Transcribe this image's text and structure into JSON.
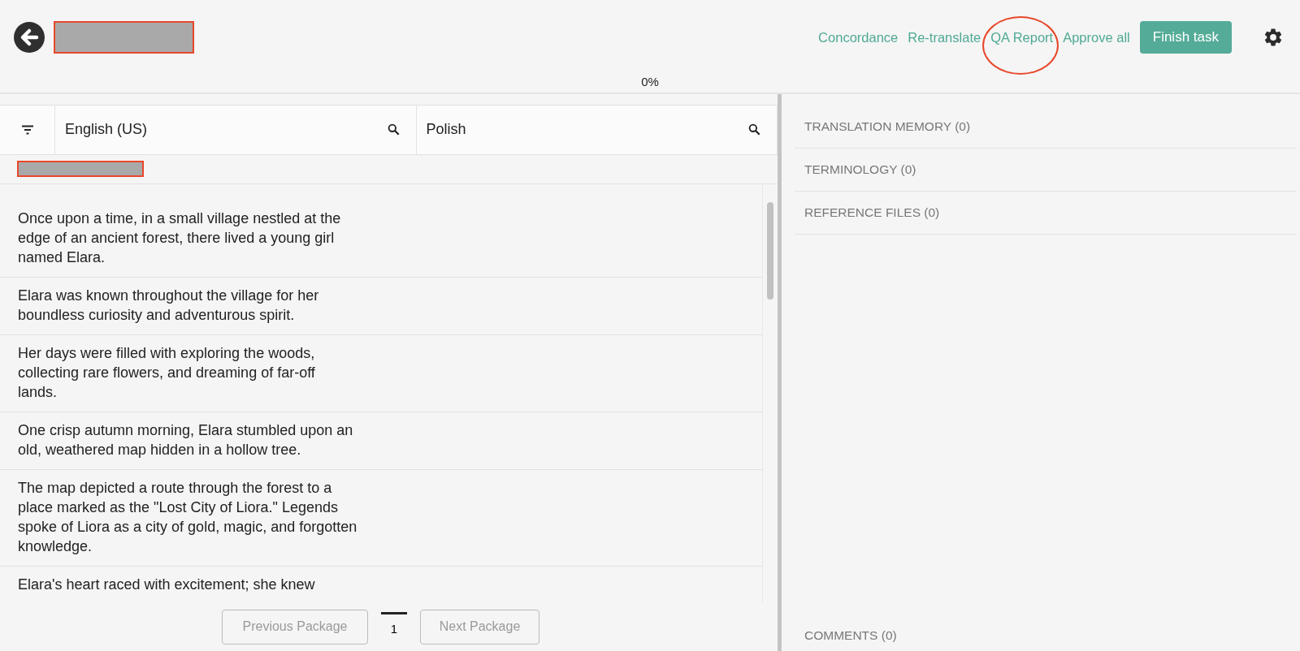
{
  "header": {
    "actions": [
      {
        "label": "Concordance",
        "circled": false
      },
      {
        "label": "Re-translate",
        "circled": false
      },
      {
        "label": "QA Report",
        "circled": true
      },
      {
        "label": "Approve all",
        "circled": false
      }
    ],
    "finish_button": "Finish task",
    "progress": "0%"
  },
  "editor": {
    "columns": [
      {
        "label": "English (US)"
      },
      {
        "label": "Polish"
      }
    ],
    "segments": [
      {
        "source": "Once upon a time, in a small village nestled at the edge of an ancient forest, there lived a young girl named Elara."
      },
      {
        "source": "Elara was known throughout the village for her boundless curiosity and adventurous spirit."
      },
      {
        "source": "Her days were filled with exploring the woods, collecting rare flowers, and dreaming of far-off lands."
      },
      {
        "source": "One crisp autumn morning, Elara stumbled upon an old, weathered map hidden in a hollow tree."
      },
      {
        "source": "The map depicted a route through the forest to a place marked as the \"Lost City of Liora.\" Legends spoke of Liora as a city of gold, magic, and forgotten knowledge."
      },
      {
        "source": "Elara's heart raced with excitement; she knew"
      }
    ],
    "pagination": {
      "previous": "Previous Package",
      "page": "1",
      "next": "Next Package",
      "previous_disabled": true,
      "next_disabled": true
    }
  },
  "side_panel": {
    "sections": [
      {
        "label": "TRANSLATION MEMORY (0)"
      },
      {
        "label": "TERMINOLOGY (0)"
      },
      {
        "label": "REFERENCE FILES (0)"
      }
    ],
    "comments": "COMMENTS (0)"
  }
}
